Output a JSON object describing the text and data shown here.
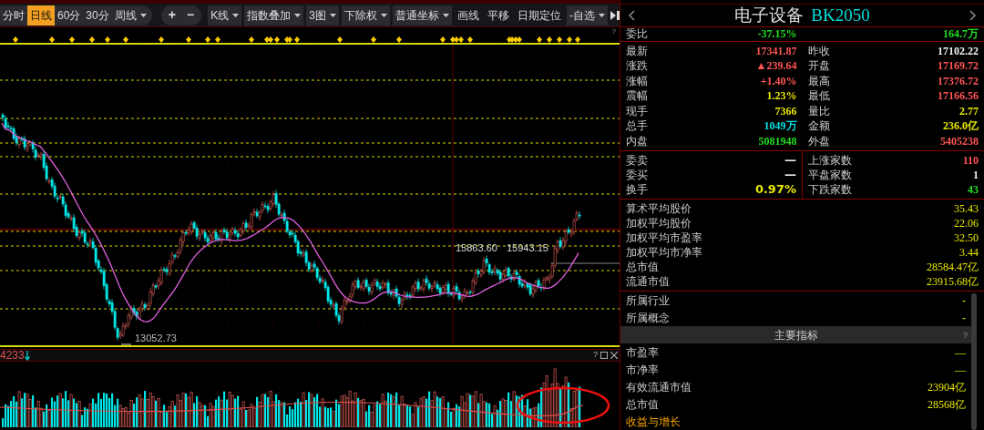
{
  "toolbar": {
    "periods": [
      {
        "label": "分时",
        "selected": false,
        "kind": "plain"
      },
      {
        "label": "日线",
        "selected": true,
        "kind": "plain"
      },
      {
        "label": "60分",
        "selected": false,
        "kind": "plain"
      },
      {
        "label": "30分",
        "selected": false,
        "kind": "plain"
      },
      {
        "label": "周线",
        "selected": false,
        "kind": "dropdown"
      }
    ],
    "zoom_buttons": [
      "+",
      "−"
    ],
    "tools": [
      {
        "label": "K线",
        "kind": "dropdown"
      },
      {
        "label": "指数叠加",
        "kind": "dropdown"
      },
      {
        "label": "3图",
        "kind": "dropdown"
      },
      {
        "label": "下除权",
        "kind": "dropdown"
      },
      {
        "label": "普通坐标",
        "kind": "dropdown"
      },
      {
        "label": "画线",
        "kind": "plain"
      },
      {
        "label": "平移",
        "kind": "plain"
      },
      {
        "label": "日期定位",
        "kind": "plain"
      },
      {
        "label": "-自选",
        "kind": "dropdown"
      }
    ],
    "help": "?"
  },
  "chart": {
    "low_label": "13052.73",
    "label_a": "15863.60",
    "label_b": "15943.15"
  },
  "volume": {
    "reading": "4233",
    "help": "?"
  },
  "panel": {
    "name": "电子设备",
    "code": "BK2050",
    "ratio": {
      "label": "委比",
      "value": "-37.15%",
      "color": "#22dd22"
    },
    "ratio_volume": {
      "value": "164.7万",
      "color": "#22dd22"
    },
    "quote_rows": [
      {
        "left": {
          "label": "最新",
          "value": "17341.87",
          "color": "#ff5555"
        },
        "right": {
          "label": "昨收",
          "value": "17102.22",
          "color": "#eeeeee"
        }
      },
      {
        "left": {
          "label": "涨跌",
          "value": "▲239.64",
          "color": "#ff5555"
        },
        "right": {
          "label": "开盘",
          "value": "17169.72",
          "color": "#ff5555"
        }
      },
      {
        "left": {
          "label": "涨幅",
          "value": "+1.40%",
          "color": "#ff5555"
        },
        "right": {
          "label": "最高",
          "value": "17376.72",
          "color": "#ff5555"
        }
      },
      {
        "left": {
          "label": "震幅",
          "value": "1.23%",
          "color": "#e6e600"
        },
        "right": {
          "label": "最低",
          "value": "17166.56",
          "color": "#ff5555"
        }
      },
      {
        "left": {
          "label": "现手",
          "value": "7366",
          "color": "#e6e600"
        },
        "right": {
          "label": "量比",
          "value": "2.77",
          "color": "#e6e600"
        }
      },
      {
        "left": {
          "label": "总手",
          "value": "1049万",
          "color": "#00dddd"
        },
        "right": {
          "label": "金额",
          "value": "236.0亿",
          "color": "#e6e600"
        }
      },
      {
        "left": {
          "label": "内盘",
          "value": "5081948",
          "color": "#22dd22"
        },
        "right": {
          "label": "外盘",
          "value": "5405238",
          "color": "#ff5555"
        }
      }
    ],
    "order_rows": [
      {
        "left": {
          "label": "委卖",
          "value": "—",
          "color": "#eeeeee"
        },
        "right": {
          "label": "上涨家数",
          "value": "110",
          "color": "#ff5555"
        }
      },
      {
        "left": {
          "label": "委买",
          "value": "—",
          "color": "#eeeeee"
        },
        "right": {
          "label": "平盘家数",
          "value": "1",
          "color": "#eeeeee"
        }
      },
      {
        "left": {
          "label": "换手",
          "value": "0.97%",
          "color": "#e6e600"
        },
        "right": {
          "label": "下跌家数",
          "value": "43",
          "color": "#22dd22"
        }
      }
    ],
    "averages": [
      {
        "label": "算术平均股价",
        "value": "35.43"
      },
      {
        "label": "加权平均股价",
        "value": "22.06"
      },
      {
        "label": "加权平均市盈率",
        "value": "32.50"
      },
      {
        "label": "加权平均市净率",
        "value": "3.44"
      },
      {
        "label": "总市值",
        "value": "28584.47亿"
      },
      {
        "label": "流通市值",
        "value": "23915.68亿"
      }
    ],
    "belongs": [
      {
        "label": "所属行业",
        "value": "-"
      },
      {
        "label": "所属概念",
        "value": "-"
      }
    ],
    "section_title": "主要指标",
    "section_help": "?",
    "indicators": [
      {
        "label": "市盈率",
        "value": "—"
      },
      {
        "label": "市净率",
        "value": "—"
      },
      {
        "label": "有效流通市值",
        "value": "23904亿"
      },
      {
        "label": "总市值",
        "value": "28568亿"
      }
    ],
    "subsection": "收益与增长"
  }
}
